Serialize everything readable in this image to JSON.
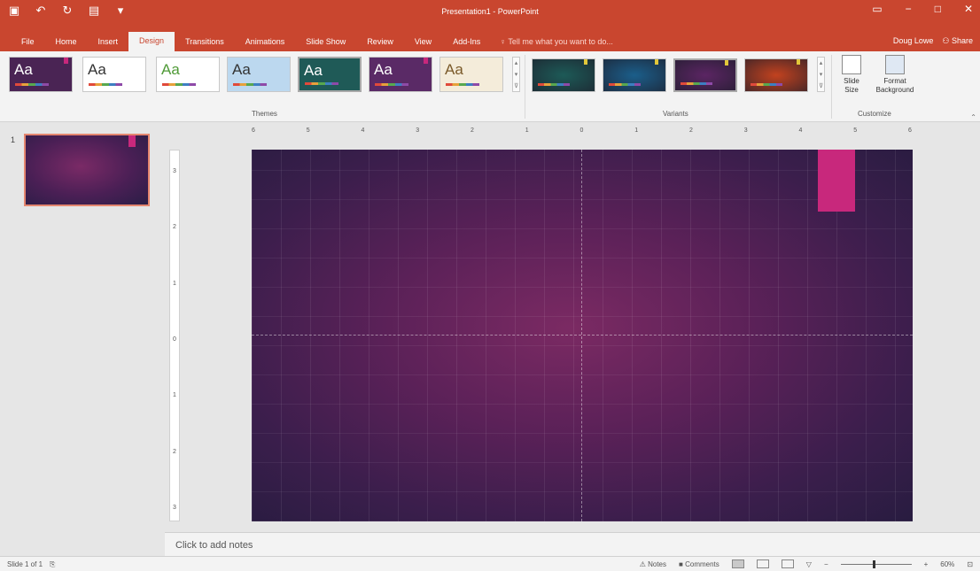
{
  "window": {
    "title": "Presentation1 - PowerPoint"
  },
  "qat": {
    "save_icon": "save-icon",
    "undo_icon": "undo-icon",
    "redo_icon": "redo-icon",
    "present_icon": "present-icon",
    "customize_icon": "customize-qat-icon"
  },
  "tabs": [
    {
      "label": "File"
    },
    {
      "label": "Home"
    },
    {
      "label": "Insert"
    },
    {
      "label": "Design"
    },
    {
      "label": "Transitions"
    },
    {
      "label": "Animations"
    },
    {
      "label": "Slide Show"
    },
    {
      "label": "Review"
    },
    {
      "label": "View"
    },
    {
      "label": "Add-Ins"
    }
  ],
  "tellme": "Tell me what you want to do...",
  "user": {
    "name": "Doug Lowe",
    "share": "Share"
  },
  "ribbon": {
    "themes_label": "Themes",
    "variants_label": "Variants",
    "customize_label": "Customize",
    "themes": [
      {
        "aa": "Aa",
        "bg": "#4a2454",
        "fg": "#ffffff"
      },
      {
        "aa": "Aa",
        "bg": "#ffffff",
        "fg": "#333333"
      },
      {
        "aa": "Aa",
        "bg": "#ffffff",
        "fg": "#4f9a37"
      },
      {
        "aa": "Aa",
        "bg": "#bcd8ef",
        "fg": "#333333"
      },
      {
        "aa": "Aa",
        "bg": "#1f5a57",
        "fg": "#ffffff"
      },
      {
        "aa": "Aa",
        "bg": "#5a2a66",
        "fg": "#ffffff"
      },
      {
        "aa": "Aa",
        "bg": "#f4ecda",
        "fg": "#7a5a2a"
      }
    ],
    "variants": [
      {
        "bg": "#1d5a57"
      },
      {
        "bg": "#1b5e8a"
      },
      {
        "bg": "#5b2563"
      },
      {
        "bg": "#c2421f"
      }
    ],
    "slide_size_label": "Slide\nSize",
    "format_background_label": "Format\nBackground"
  },
  "thumbnails": [
    {
      "number": "1"
    }
  ],
  "ruler_h": [
    "6",
    "5",
    "4",
    "3",
    "2",
    "1",
    "0",
    "1",
    "2",
    "3",
    "4",
    "5",
    "6"
  ],
  "ruler_v": [
    "3",
    "2",
    "1",
    "0",
    "1",
    "2",
    "3"
  ],
  "notes": {
    "placeholder": "Click to add notes"
  },
  "status": {
    "slide_info": "Slide 1 of 1",
    "notes_label": "Notes",
    "comments_label": "Comments",
    "zoom": "60%"
  },
  "colors": {
    "accent": "#c9462f",
    "slide_flag": "#c8287c"
  }
}
